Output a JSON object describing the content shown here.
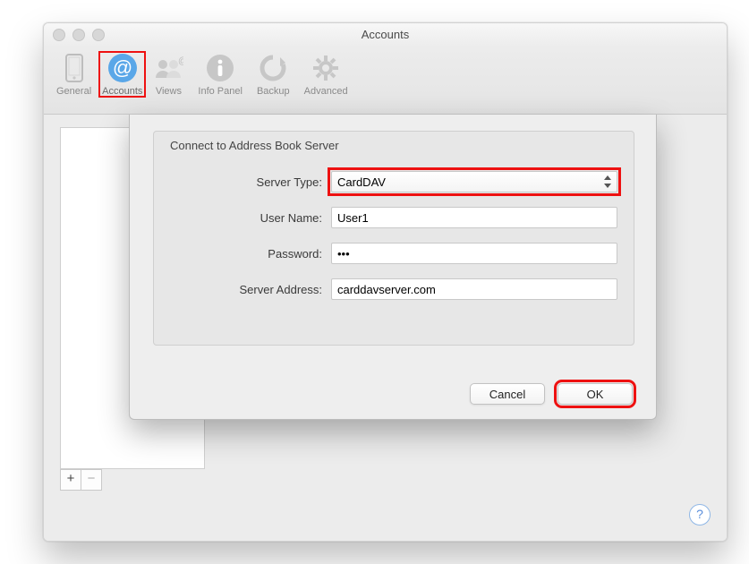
{
  "window": {
    "title": "Accounts"
  },
  "toolbar": {
    "items": [
      {
        "label": "General",
        "icon": "phone-icon"
      },
      {
        "label": "Accounts",
        "icon": "at-icon"
      },
      {
        "label": "Views",
        "icon": "contacts-icon"
      },
      {
        "label": "Info Panel",
        "icon": "info-icon"
      },
      {
        "label": "Backup",
        "icon": "backup-icon"
      },
      {
        "label": "Advanced",
        "icon": "gear-icon"
      }
    ]
  },
  "sheet": {
    "title": "Connect to Address Book Server",
    "labels": {
      "server_type": "Server Type:",
      "user_name": "User Name:",
      "password": "Password:",
      "server_address": "Server Address:"
    },
    "values": {
      "server_type": "CardDAV",
      "user_name": "User1",
      "password": "•••",
      "server_address": "carddavserver.com"
    },
    "buttons": {
      "cancel": "Cancel",
      "ok": "OK"
    }
  },
  "footer": {
    "add": "+",
    "remove": "−",
    "help": "?"
  }
}
